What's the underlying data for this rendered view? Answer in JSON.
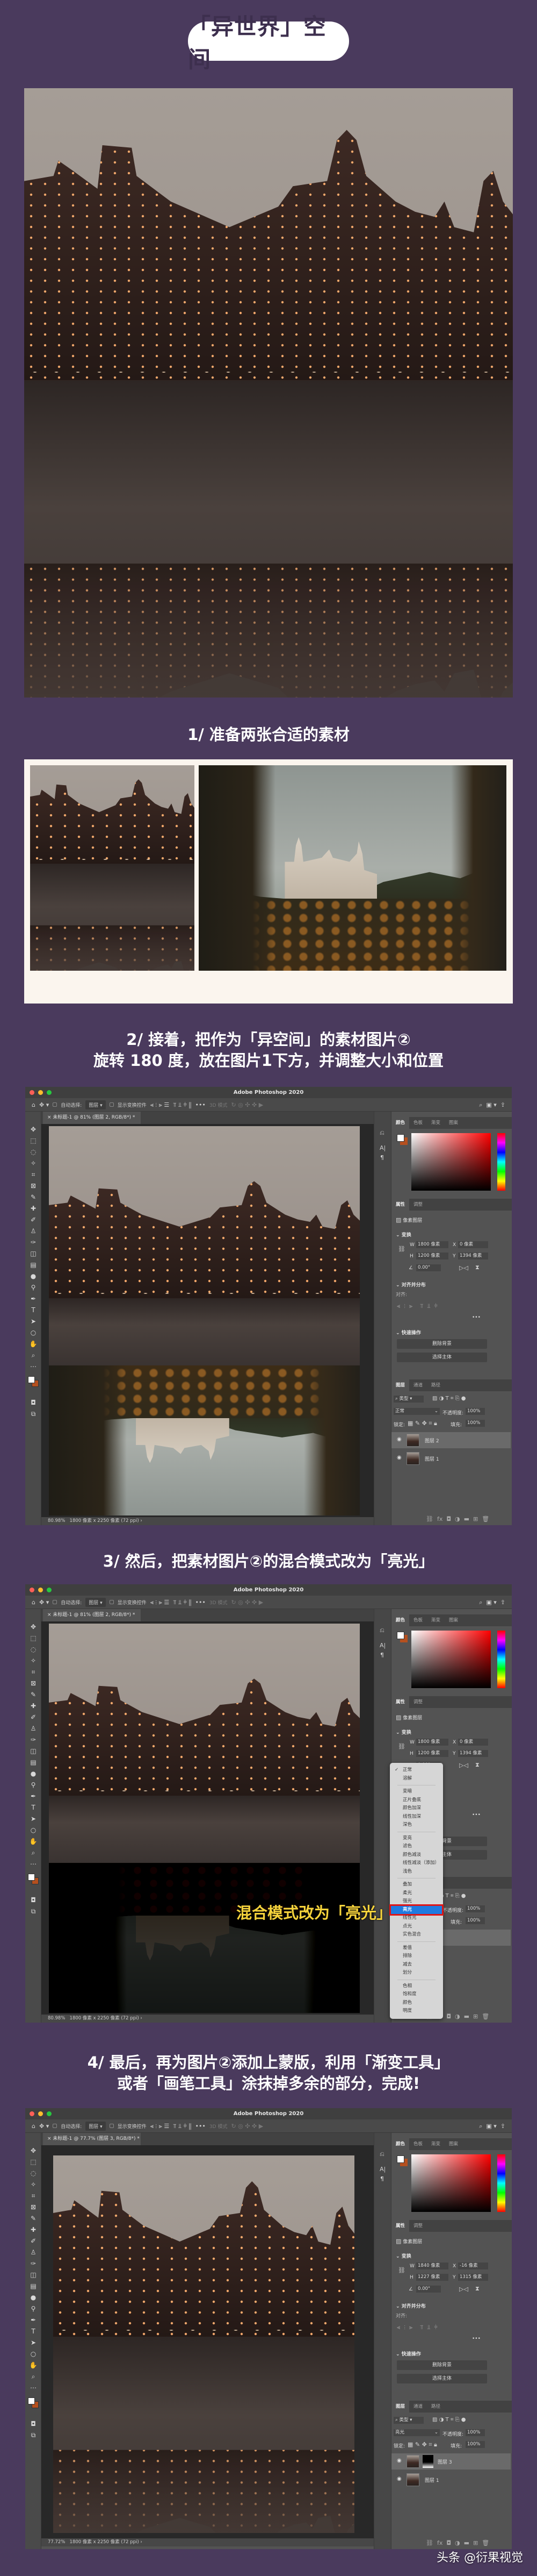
{
  "title": "「异世界」空间",
  "steps": [
    {
      "lines": [
        "1/ 准备两张合适的素材"
      ]
    },
    {
      "lines": [
        "2/ 接着，把作为「异空间」的素材图片②",
        "旋转 180 度，放在图片1下方，并调整大小和位置"
      ]
    },
    {
      "lines": [
        "3/ 然后，把素材图片②的混合模式改为「亮光」"
      ]
    },
    {
      "lines": [
        "4/ 最后，再为图片②添加上蒙版，利用「渐变工具」",
        "或者「画笔工具」涂抹掉多余的部分，完成!"
      ]
    }
  ],
  "ps": {
    "app_title": "Adobe Photoshop 2020",
    "auto_select": "自动选择:",
    "layer_dropdown": "图层",
    "show_transform": "显示变换控件",
    "mode_3d": "3D 模式",
    "color_tabs": [
      "颜色",
      "色板",
      "渐变",
      "图案"
    ],
    "props_tabs": [
      "属性",
      "调整"
    ],
    "pixel_layer": "像素图层",
    "transform": "变换",
    "align_section": "对齐并分布",
    "align_label": "对齐:",
    "quick_actions": "快速操作",
    "remove_bg": "删除背景",
    "select_subject": "选择主体",
    "layers_tabs": [
      "图层",
      "通道",
      "路径"
    ],
    "filter": "类型",
    "opacity_label": "不透明度:",
    "lock_label": "锁定:",
    "fill_label": "填充:",
    "more": "•••"
  },
  "windows": [
    {
      "tab": "未标题-1 @ 81% (图层 2, RGB/8*) *",
      "zoom": "80.98%",
      "doc": "1800 像素 x 2250 像素 (72 ppi)",
      "w": "1800 像素",
      "h": "1200 像素",
      "x": "0 像素",
      "y": "1394 像素",
      "angle": "0.00°",
      "blend": "正常",
      "opacity": "100%",
      "fill": "100%",
      "layers": [
        "图层 2",
        "图层 1"
      ]
    },
    {
      "tab": "未标题-1 @ 81% (图层 2, RGB/8*) *",
      "zoom": "80.98%",
      "doc": "1800 像素 x 2250 像素 (72 ppi)",
      "w": "1800 像素",
      "h": "1200 像素",
      "x": "0 像素",
      "y": "1394 像素",
      "angle": "0.00°",
      "blend": "正常",
      "opacity": "100%",
      "fill": "100%",
      "layers": [
        "图层 2",
        "图层 1"
      ]
    },
    {
      "tab": "未标题-1 @ 77.7% (图层 3, RGB/8*) *",
      "zoom": "77.72%",
      "doc": "1800 像素 x 2250 像素 (72 ppi)",
      "w": "1840 像素",
      "h": "1227 像素",
      "x": "-16 像素",
      "y": "1315 像素",
      "angle": "0.00°",
      "blend": "亮光",
      "opacity": "100%",
      "fill": "100%",
      "layers": [
        "图层 3",
        "图层 1"
      ]
    }
  ],
  "blend_menu": {
    "groups": [
      [
        "正常",
        "溶解"
      ],
      [
        "变暗",
        "正片叠底",
        "颜色加深",
        "线性加深",
        "深色"
      ],
      [
        "变亮",
        "滤色",
        "颜色减淡",
        "线性减淡（添加）",
        "浅色"
      ],
      [
        "叠加",
        "柔光",
        "强光",
        "亮光",
        "线性光",
        "点光",
        "实色混合"
      ],
      [
        "差值",
        "排除",
        "减去",
        "划分"
      ],
      [
        "色相",
        "饱和度",
        "颜色",
        "明度"
      ]
    ],
    "checked": "正常",
    "selected": "亮光",
    "annotation": "混合模式改为「亮光」"
  },
  "watermark": "头条 @衍果视觉",
  "colors": {
    "background": "#4a3a5d",
    "highlight": "#1f7ae0",
    "highlight_border": "#e01515",
    "annotation": "#f6d33c"
  }
}
